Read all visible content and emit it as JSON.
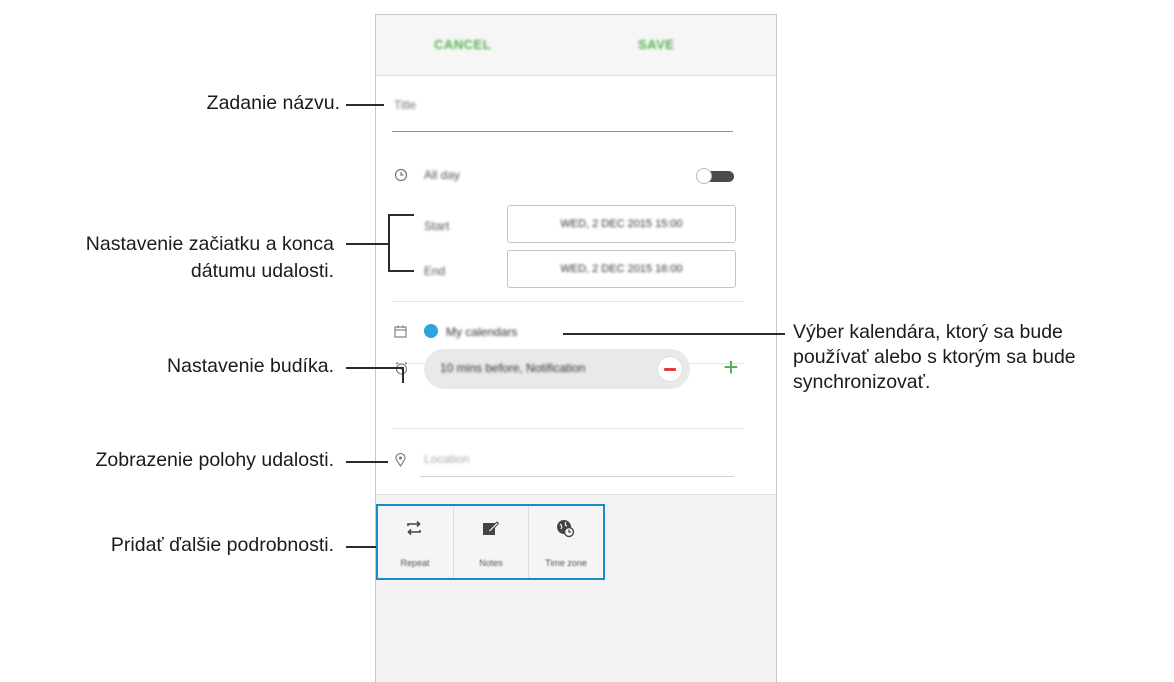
{
  "app": {
    "cancel_label": "CANCEL",
    "save_label": "SAVE",
    "title_placeholder": "Title",
    "all_day_label": "All day",
    "start_label": "Start",
    "end_label": "End",
    "start_value": "WED, 2 DEC 2015 15:00",
    "end_value": "WED, 2 DEC 2015 16:00",
    "calendar_label": "My calendars",
    "reminder_label": "10 mins before, Notification",
    "location_placeholder": "Location",
    "tabs": [
      {
        "label": "Repeat",
        "icon": "repeat-icon"
      },
      {
        "label": "Notes",
        "icon": "notes-icon"
      },
      {
        "label": "Time zone",
        "icon": "time-zone-icon"
      }
    ],
    "all_day_enabled": false,
    "accent_color": "#52b252",
    "calendar_color": "#2fa3dc"
  },
  "callouts": {
    "title": "Zadanie názvu.",
    "dates_line1": "Nastavenie začiatku a konca",
    "dates_line2": "dátumu udalosti.",
    "alarm": "Nastavenie budíka.",
    "location": "Zobrazenie polohy udalosti.",
    "details": "Pridať ďalšie podrobnosti.",
    "calendar_line1": "Výber kalendára, ktorý sa bude",
    "calendar_line2": "používať alebo s ktorým sa bude",
    "calendar_line3": "synchronizovať."
  }
}
